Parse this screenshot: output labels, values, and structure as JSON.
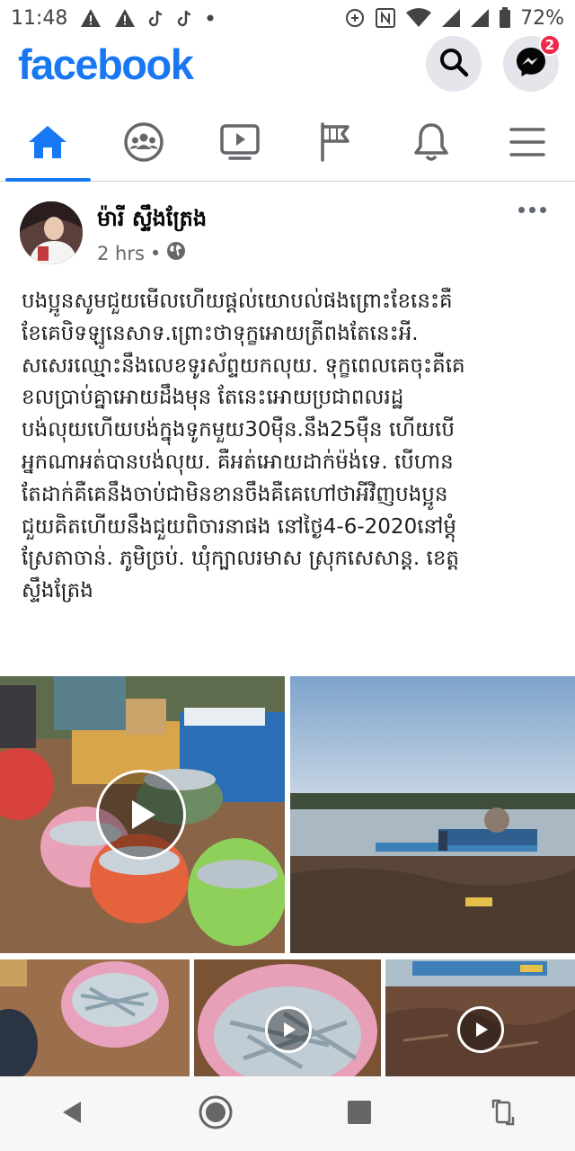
{
  "status_bar": {
    "time": "11:48",
    "battery": "72%",
    "icons": [
      "warning-icon",
      "warning-icon",
      "tiktok-icon",
      "tiktok-icon",
      "dot-icon",
      "data-saver-icon",
      "nfc-icon",
      "wifi-icon",
      "signal-icon",
      "signal-icon",
      "battery-icon"
    ]
  },
  "header": {
    "logo": "facebook",
    "search_icon": "search-icon",
    "messenger_icon": "messenger-icon",
    "messenger_badge": "2"
  },
  "tabs": [
    {
      "name": "home",
      "icon": "home-icon",
      "active": true
    },
    {
      "name": "groups",
      "icon": "groups-icon",
      "active": false
    },
    {
      "name": "watch",
      "icon": "video-icon",
      "active": false
    },
    {
      "name": "pages",
      "icon": "flag-icon",
      "active": false
    },
    {
      "name": "notifications",
      "icon": "bell-icon",
      "active": false
    },
    {
      "name": "menu",
      "icon": "menu-icon",
      "active": false
    }
  ],
  "post": {
    "author": "ម៉ារី ស្ទឹងត្រែង",
    "time": "2 hrs",
    "separator": "•",
    "privacy_icon": "globe-icon",
    "text_lines": [
      "បងប្អូនសូមជួយមើលហើយផ្តល់យោបល់ផងព្រោះខែនេះគឺ",
      "ខែគេបិទឡូនេសាទ.ព្រោះថាទុក្ខអោយត្រីពងតែនេះអី.",
      "សសេរឈ្មោះនឹងលេខទូរស័ព្ទយកលុយ. ទុក្ខពេលគេចុះគឺគេ",
      "ខលប្រាប់គ្នាអោយដឹងមុន តែនេះអោយប្រជាពលរដ្ឋ",
      "បង់លុយហើយបង់ក្នុងទូកមួយ30ម៉ឺន.នឹង25ម៉ឺន ហើយបើ",
      "អ្នកណាអត់បានបង់លុយ. គឺអត់អោយដាក់ម៉ង់ទេ. បើហាន",
      "តែដាក់គឺគេនឹងចាប់ជាមិនខានចឹងគឺគេហៅថាអីវិញបងប្អូន",
      "ជួយគិតហើយនឹងជួយពិចារនាផង នៅថ្ងៃ4-6-2020នៅម្តុំ",
      "ស្រែតាចាន់.  ភូមិច្រប់. ឃុំក្បាលរមាស ស្រុកសេសាន្ត. ខេត្ត",
      "ស្ទឹងត្រែង"
    ],
    "media": [
      {
        "name": "photo-fish-baskets",
        "video": true
      },
      {
        "name": "photo-river-boats",
        "video": false
      },
      {
        "name": "photo-pink-basket-fish",
        "video": false
      },
      {
        "name": "photo-fish-closeup",
        "video": true
      },
      {
        "name": "photo-riverbank",
        "video": true
      }
    ]
  },
  "nav_bar": {
    "icons": [
      "back-icon",
      "home-circle-icon",
      "recents-icon",
      "rotate-icon"
    ]
  }
}
